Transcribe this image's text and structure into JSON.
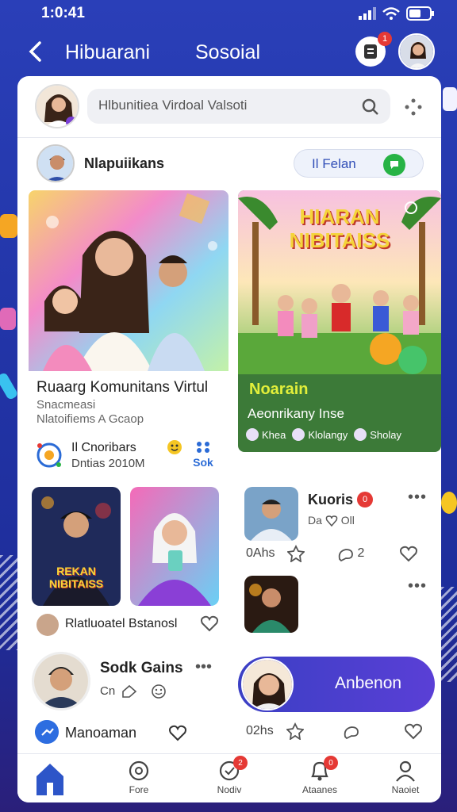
{
  "status_bar": {
    "time": "1:0:41"
  },
  "header": {
    "tab_left": "Hibuarani",
    "tab_right": "Sosoial",
    "notif_badge": "1"
  },
  "search": {
    "placeholder": "Hlbunitiea Virdoal Valsoti"
  },
  "friend": {
    "name": "Nlapuiikans",
    "follow_label": "Felan",
    "follow_prefix": "Il"
  },
  "post1": {
    "title": "Ruaarg Komunitans Virtul",
    "sub1": "Snacmeasi",
    "sub2": "Nlatoifiems A Gcaop",
    "footer_line1": "Il Cnoribars",
    "footer_line2": "Dntias 2010M",
    "footer_right": "Sok"
  },
  "post2": {
    "banner_line1": "HIARAN",
    "banner_line2": "NIBITAISS",
    "title": "Noarain",
    "subtitle": "Aeonrikany Inse",
    "tags": [
      "Khea",
      "Klolangy",
      "Sholay"
    ]
  },
  "thumb1_text": [
    "REKAN",
    "NIBITAISS"
  ],
  "row_name": "Rlatluoatel Bstanosl",
  "kuor": {
    "name": "Kuoris",
    "badge": "0",
    "meta": "Da",
    "meta2": "Oll",
    "like_count": "0Ahs",
    "share_count": "2"
  },
  "sodk": {
    "name": "Sodk Gains",
    "meta": "Cn"
  },
  "mano": {
    "label": "Manoaman"
  },
  "act2": {
    "count": "02hs"
  },
  "anbenon": {
    "label": "Anbenon"
  },
  "nav": [
    {
      "label": "",
      "badge": ""
    },
    {
      "label": "Fore",
      "badge": ""
    },
    {
      "label": "Nodiv",
      "badge": "2"
    },
    {
      "label": "Ataanes",
      "badge": "0"
    },
    {
      "label": "Naoiet",
      "badge": ""
    }
  ],
  "colors": {
    "accent": "#2a3fb8",
    "badge": "#e53935",
    "green": "#27b345"
  }
}
